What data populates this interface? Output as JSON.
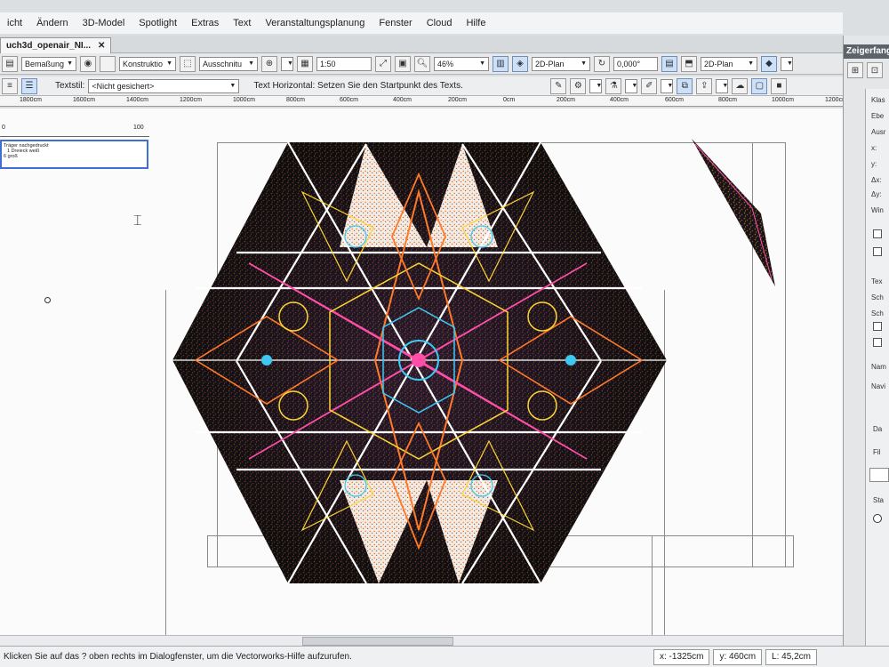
{
  "menu": [
    "icht",
    "Ändern",
    "3D-Model",
    "Spotlight",
    "Extras",
    "Text",
    "Veranstaltungsplanung",
    "Fenster",
    "Cloud",
    "Hilfe"
  ],
  "document_tab": {
    "title": "uch3d_openair_NI...",
    "close": "✕"
  },
  "modebar": {
    "layer": "Bemaßung",
    "class": "Konstruktio",
    "view": "Ausschnitu",
    "scale": "1:50",
    "zoom": "46%",
    "plan_view": "2D-Plan",
    "rotation": "0,000°",
    "plan_view2": "2D-Plan"
  },
  "text_toolbar": {
    "textstil_label": "Textstil:",
    "textstil_value": "<Nicht gesichert>",
    "hint": "Text Horizontal: Setzen Sie den Startpunkt des Texts."
  },
  "ruler_labels": [
    "1800cm",
    "1600cm",
    "1400cm",
    "1200cm",
    "1000cm",
    "800cm",
    "600cm",
    "400cm",
    "200cm",
    "0cm",
    "200cm",
    "400cm",
    "600cm",
    "800cm",
    "1000cm",
    "1200cm"
  ],
  "mini_ruler": [
    "0",
    "100"
  ],
  "label_box": {
    "line1": "Träger nachgedruckt",
    "line2": "1 Dreieck weiß",
    "line3": "6 groß"
  },
  "right_panel": {
    "title": "Zeigerfang",
    "labels": [
      "Klas",
      "Ebe",
      "Ausr",
      "x:",
      "y:",
      "Δx:",
      "Δy:",
      "Win",
      "Tex",
      "Sch",
      "Sch",
      "Nam",
      "Navi",
      "Da",
      "Fil",
      "Sta"
    ]
  },
  "status": {
    "help": "Klicken Sie auf das ? oben rechts im Dialogfenster, um die Vectorworks-Hilfe aufzurufen.",
    "x": "x: -1325cm",
    "y": "y: 460cm",
    "l": "L: 45,2cm"
  },
  "colors": {
    "mandala_black": "#121212",
    "orange": "#ff7a2a",
    "magenta": "#ff4ea8",
    "yellow": "#ffd534",
    "cyan": "#3ec9f2",
    "selection_blue": "#3f6fd3"
  }
}
